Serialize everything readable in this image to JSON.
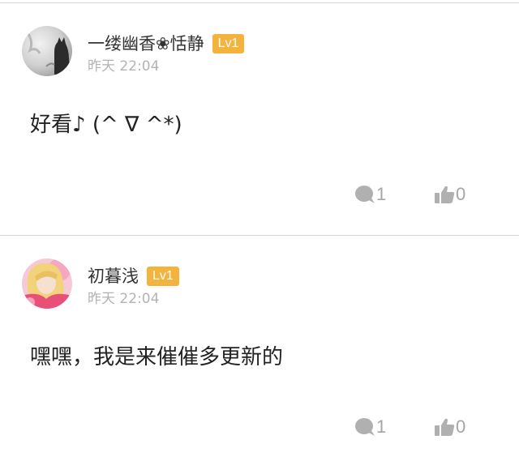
{
  "comments": [
    {
      "username": "一缕幽香❀恬静",
      "level": "Lv1",
      "timestamp": "昨天 22:04",
      "text": "好看♪ (^ ∇ ^*)",
      "reply_count": "1",
      "like_count": "0",
      "avatar_icon": "avatar-cat-photo"
    },
    {
      "username": "初暮浅",
      "level": "Lv1",
      "timestamp": "昨天 22:04",
      "text": "嘿嘿，我是来催催多更新的",
      "reply_count": "1",
      "like_count": "0",
      "avatar_icon": "avatar-girl-photo"
    }
  ],
  "colors": {
    "badge": "#f4b33c",
    "muted": "#a6a6a6",
    "divider": "#d6d6d6"
  }
}
